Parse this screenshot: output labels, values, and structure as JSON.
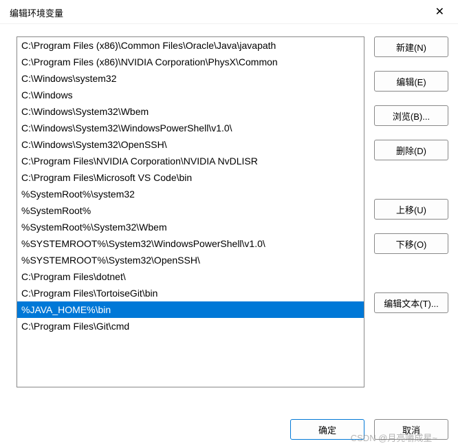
{
  "window": {
    "title": "编辑环境变量",
    "close_glyph": "✕"
  },
  "list": {
    "selected_index": 16,
    "items": [
      "C:\\Program Files (x86)\\Common Files\\Oracle\\Java\\javapath",
      "C:\\Program Files (x86)\\NVIDIA Corporation\\PhysX\\Common",
      "C:\\Windows\\system32",
      "C:\\Windows",
      "C:\\Windows\\System32\\Wbem",
      "C:\\Windows\\System32\\WindowsPowerShell\\v1.0\\",
      "C:\\Windows\\System32\\OpenSSH\\",
      "C:\\Program Files\\NVIDIA Corporation\\NVIDIA NvDLISR",
      "C:\\Program Files\\Microsoft VS Code\\bin",
      "%SystemRoot%\\system32",
      "%SystemRoot%",
      "%SystemRoot%\\System32\\Wbem",
      "%SYSTEMROOT%\\System32\\WindowsPowerShell\\v1.0\\",
      "%SYSTEMROOT%\\System32\\OpenSSH\\",
      "C:\\Program Files\\dotnet\\",
      "C:\\Program Files\\TortoiseGit\\bin",
      "%JAVA_HOME%\\bin",
      "C:\\Program Files\\Git\\cmd"
    ]
  },
  "buttons": {
    "new": "新建(N)",
    "edit": "编辑(E)",
    "browse": "浏览(B)...",
    "delete": "删除(D)",
    "move_up": "上移(U)",
    "move_down": "下移(O)",
    "edit_text": "编辑文本(T)...",
    "ok": "确定",
    "cancel": "取消"
  },
  "watermark": "CSDN @月亮嚼成星~"
}
